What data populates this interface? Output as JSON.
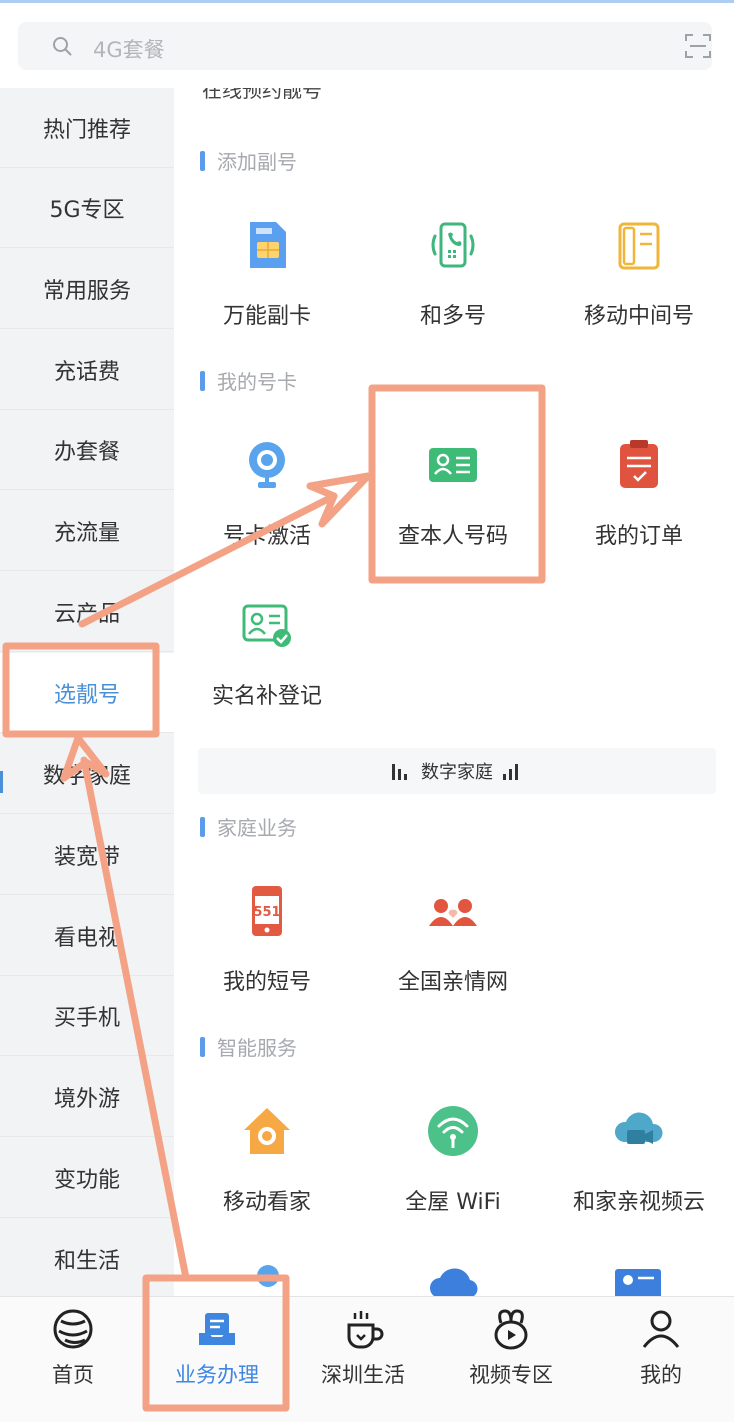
{
  "search": {
    "placeholder": "4G套餐"
  },
  "sidebar": {
    "items": [
      {
        "label": "热门推荐"
      },
      {
        "label": "5G专区"
      },
      {
        "label": "常用服务"
      },
      {
        "label": "充话费"
      },
      {
        "label": "办套餐"
      },
      {
        "label": "充流量"
      },
      {
        "label": "云产品"
      },
      {
        "label": "选靓号",
        "active": true
      },
      {
        "label": "数字家庭"
      },
      {
        "label": "装宽带"
      },
      {
        "label": "看电视"
      },
      {
        "label": "买手机"
      },
      {
        "label": "境外游"
      },
      {
        "label": "变功能"
      },
      {
        "label": "和生活"
      }
    ]
  },
  "sections": {
    "cut_text": "在线预约靓号",
    "add_number": {
      "title": "添加副号",
      "items": [
        {
          "label": "万能副卡",
          "icon": "sim-card-icon"
        },
        {
          "label": "和多号",
          "icon": "multi-number-icon"
        },
        {
          "label": "移动中间号",
          "icon": "middle-number-icon"
        }
      ]
    },
    "my_card": {
      "title": "我的号卡",
      "items": [
        {
          "label": "号卡激活",
          "icon": "camera-activate-icon"
        },
        {
          "label": "查本人号码",
          "icon": "id-card-icon"
        },
        {
          "label": "我的订单",
          "icon": "order-clipboard-icon"
        },
        {
          "label": "实名补登记",
          "icon": "realname-register-icon"
        }
      ]
    },
    "banner": {
      "label": "数字家庭"
    },
    "family": {
      "title": "家庭业务",
      "items": [
        {
          "label": "我的短号",
          "icon": "short-number-icon"
        },
        {
          "label": "全国亲情网",
          "icon": "family-network-icon"
        }
      ]
    },
    "smart": {
      "title": "智能服务",
      "items": [
        {
          "label": "移动看家",
          "icon": "home-camera-icon"
        },
        {
          "label": "全屋 WiFi",
          "icon": "wifi-icon"
        },
        {
          "label": "和家亲视频云",
          "icon": "video-cloud-icon"
        }
      ]
    }
  },
  "tabbar": {
    "tabs": [
      {
        "label": "首页",
        "icon": "china-mobile-logo-icon"
      },
      {
        "label": "业务办理",
        "icon": "business-icon",
        "active": true
      },
      {
        "label": "深圳生活",
        "icon": "coffee-cup-icon"
      },
      {
        "label": "视频专区",
        "icon": "video-zone-icon"
      },
      {
        "label": "我的",
        "icon": "profile-icon"
      }
    ]
  },
  "colors": {
    "accent": "#4a90d9",
    "annotation": "#f3a286",
    "section_bar": "#5b9bea",
    "sidebar_bg": "#f2f3f5"
  }
}
